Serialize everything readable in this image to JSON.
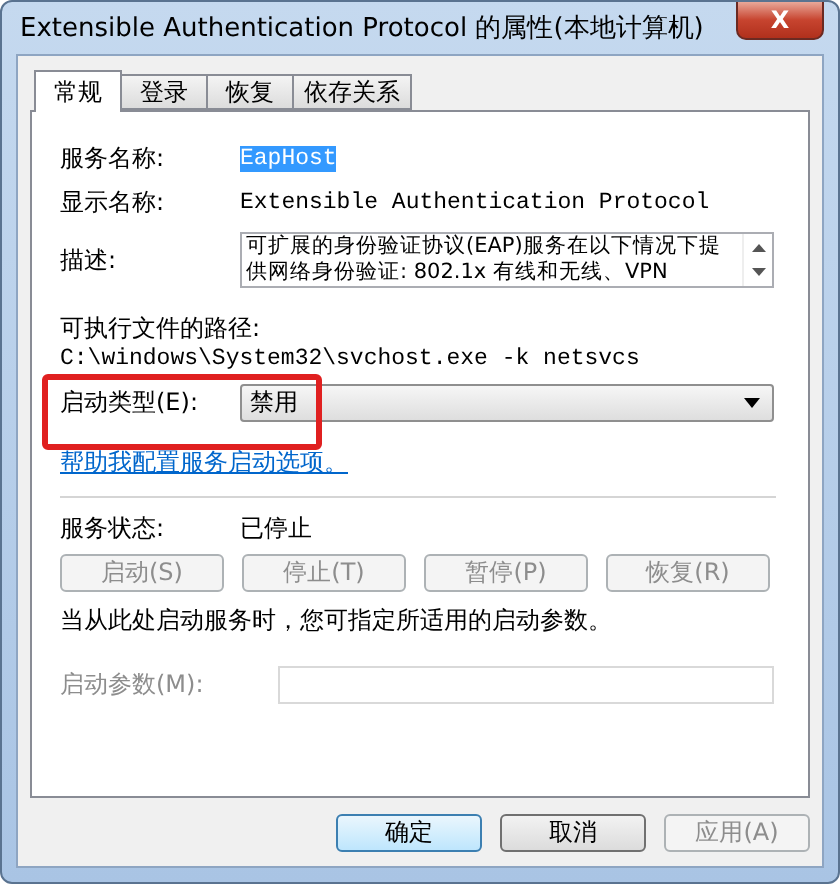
{
  "window": {
    "title": "Extensible Authentication Protocol 的属性(本地计算机)",
    "close": "X"
  },
  "tabs": [
    {
      "label": "常规",
      "selected": true
    },
    {
      "label": "登录",
      "selected": false
    },
    {
      "label": "恢复",
      "selected": false
    },
    {
      "label": "依存关系",
      "selected": false
    }
  ],
  "service_name": {
    "label": "服务名称:",
    "value": "EapHost",
    "selected": true
  },
  "display_name": {
    "label": "显示名称:",
    "value": "Extensible Authentication Protocol"
  },
  "description": {
    "label": "描述:",
    "value": "可扩展的身份验证协议(EAP)服务在以下情况下提供网络身份验证: 802.1x 有线和无线、VPN"
  },
  "executable_path": {
    "label": "可执行文件的路径:",
    "value": "C:\\windows\\System32\\svchost.exe -k netsvcs"
  },
  "startup_type": {
    "label": "启动类型(E):",
    "value": "禁用",
    "highlighted": true
  },
  "help_link": "帮助我配置服务启动选项。",
  "service_status": {
    "label": "服务状态:",
    "value": "已停止"
  },
  "control_buttons": [
    {
      "label": "启动(S)",
      "disabled": true
    },
    {
      "label": "停止(T)",
      "disabled": true
    },
    {
      "label": "暂停(P)",
      "disabled": true
    },
    {
      "label": "恢复(R)",
      "disabled": true
    }
  ],
  "start_hint": "当从此处启动服务时，您可指定所适用的启动参数。",
  "start_parameters": {
    "label": "启动参数(M):",
    "disabled": true
  },
  "dialog_buttons": [
    {
      "label": "确定",
      "disabled": false,
      "default": true
    },
    {
      "label": "取消",
      "disabled": false,
      "default": false
    },
    {
      "label": "应用(A)",
      "disabled": true,
      "default": false
    }
  ]
}
